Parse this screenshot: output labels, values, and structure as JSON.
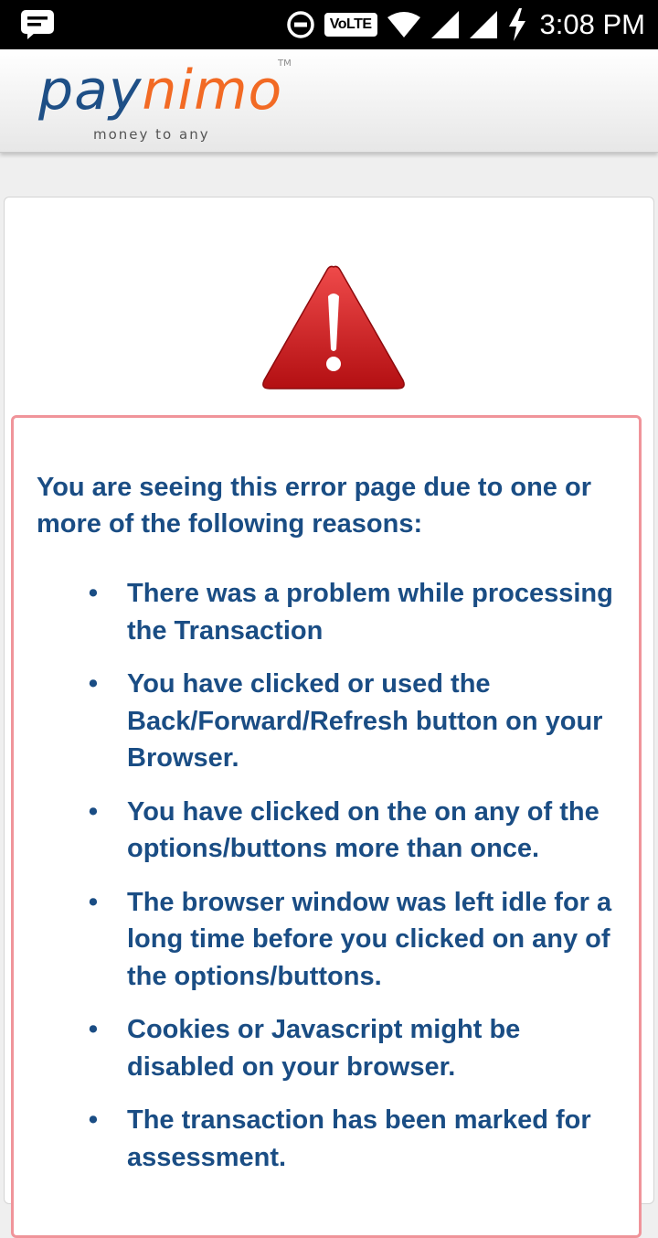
{
  "status_bar": {
    "left_icon": "message-notification-icon",
    "icons": [
      "do-not-disturb-icon",
      "volte-badge",
      "wifi-icon",
      "signal-icon",
      "signal-icon",
      "charging-icon"
    ],
    "volte_label": "VoLTE",
    "time": "3:08 PM"
  },
  "header": {
    "logo": {
      "pay": "pay",
      "nimo": "nimo",
      "tm": "TM",
      "tagline": "money to any"
    },
    "colors": {
      "pay": "#1e4f86",
      "nimo": "#f26a24"
    }
  },
  "alert": {
    "icon": "warning-triangle-icon",
    "icon_color": "#cc1b1b"
  },
  "error": {
    "intro": "You are seeing this error page due to one or more of the following reasons:",
    "text_color": "#1a4d84",
    "border_color": "#f0949a",
    "reasons": [
      "There was a problem while processing the Transaction",
      "You have clicked or used the Back/Forward/Refresh button on your Browser.",
      "You have clicked on the on any of the options/buttons more than once.",
      "The browser window was left idle for a long time before you clicked on any of the options/buttons.",
      "Cookies or Javascript might be disabled on your browser.",
      "The transaction has been marked for assessment."
    ],
    "bullet": "•"
  }
}
